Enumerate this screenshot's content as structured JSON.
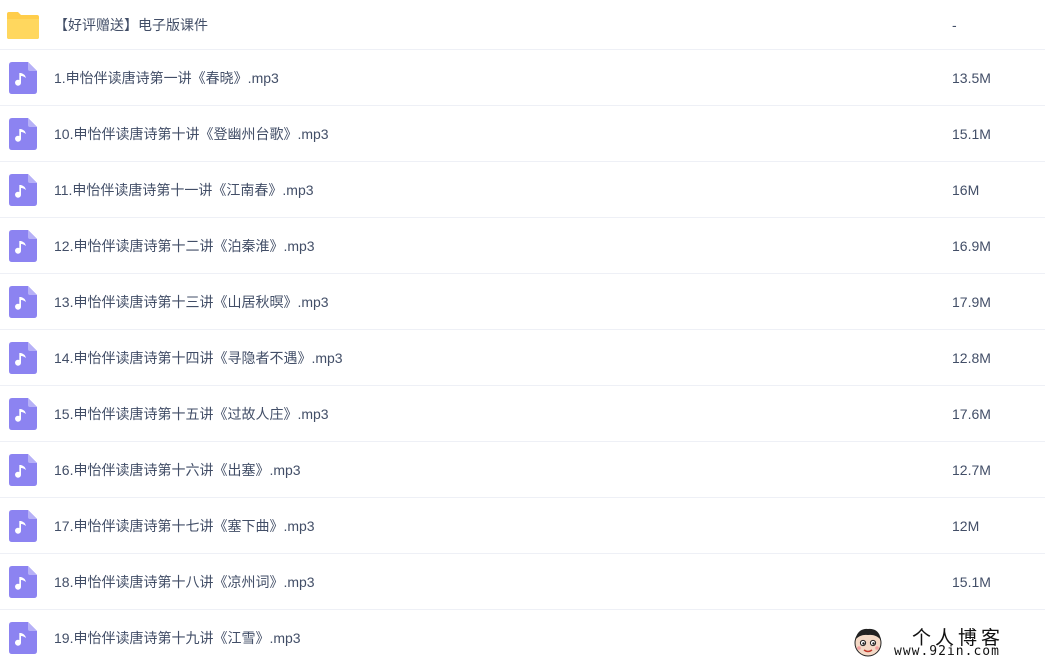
{
  "files": [
    {
      "name": "【好评赠送】电子版课件",
      "size": "-",
      "icon": "folder-icon",
      "type": "folder"
    },
    {
      "name": "1.申怡伴读唐诗第一讲《春晓》.mp3",
      "size": "13.5M",
      "icon": "audio-file-icon",
      "type": "audio"
    },
    {
      "name": "10.申怡伴读唐诗第十讲《登幽州台歌》.mp3",
      "size": "15.1M",
      "icon": "audio-file-icon",
      "type": "audio"
    },
    {
      "name": "11.申怡伴读唐诗第十一讲《江南春》.mp3",
      "size": "16M",
      "icon": "audio-file-icon",
      "type": "audio"
    },
    {
      "name": "12.申怡伴读唐诗第十二讲《泊秦淮》.mp3",
      "size": "16.9M",
      "icon": "audio-file-icon",
      "type": "audio"
    },
    {
      "name": "13.申怡伴读唐诗第十三讲《山居秋暝》.mp3",
      "size": "17.9M",
      "icon": "audio-file-icon",
      "type": "audio"
    },
    {
      "name": "14.申怡伴读唐诗第十四讲《寻隐者不遇》.mp3",
      "size": "12.8M",
      "icon": "audio-file-icon",
      "type": "audio"
    },
    {
      "name": "15.申怡伴读唐诗第十五讲《过故人庄》.mp3",
      "size": "17.6M",
      "icon": "audio-file-icon",
      "type": "audio"
    },
    {
      "name": "16.申怡伴读唐诗第十六讲《出塞》.mp3",
      "size": "12.7M",
      "icon": "audio-file-icon",
      "type": "audio"
    },
    {
      "name": "17.申怡伴读唐诗第十七讲《塞下曲》.mp3",
      "size": "12M",
      "icon": "audio-file-icon",
      "type": "audio"
    },
    {
      "name": "18.申怡伴读唐诗第十八讲《凉州词》.mp3",
      "size": "15.1M",
      "icon": "audio-file-icon",
      "type": "audio"
    },
    {
      "name": "19.申怡伴读唐诗第十九讲《江雪》.mp3",
      "size": "",
      "icon": "audio-file-icon",
      "type": "audio"
    }
  ],
  "watermark": {
    "title": "个人博客",
    "url": "www.92in.com",
    "icon": "avatar-icon"
  },
  "colors": {
    "folder": "#ffcd4a",
    "audio_icon": "#8c83f1",
    "text": "#424e67",
    "divider": "#eef0f6"
  }
}
